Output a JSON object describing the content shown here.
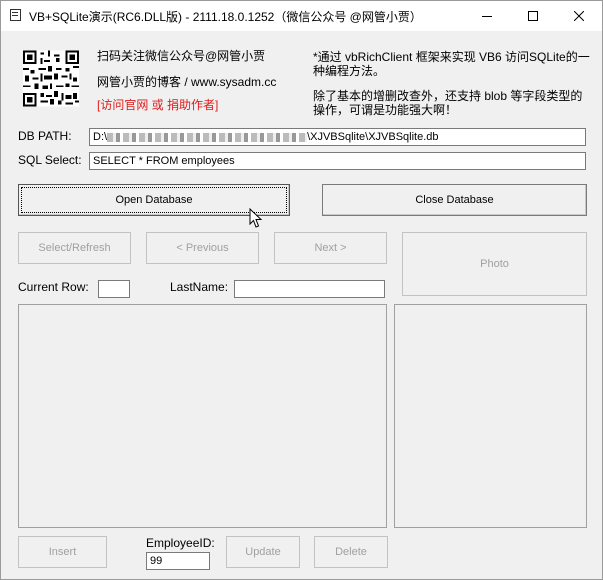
{
  "window": {
    "title": "VB+SQLite演示(RC6.DLL版) - 2111.18.0.1252（微信公众号 @网管小贾）"
  },
  "header": {
    "scan_text": "扫码关注微信公众号@网管小贾",
    "blog_text": "网管小贾的博客 / www.sysadm.cc",
    "link_text": "[访问官网 或 捐助作者]",
    "desc_line1": "*通过 vbRichClient 框架来实现 VB6 访问SQLite的一",
    "desc_line2": "种编程方法。",
    "desc_line3": "除了基本的增删改查外，还支持 blob 等字段类型的",
    "desc_line4": "操作，可谓是功能强大啊！"
  },
  "form": {
    "db_path_label": "DB PATH:",
    "db_path_prefix": "D:\\",
    "db_path_suffix": "\\XJVBSqlite\\XJVBSqlite.db",
    "sql_label": "SQL Select:",
    "sql_value": "SELECT * FROM employees",
    "current_row_label": "Current Row:",
    "current_row_value": "",
    "lastname_label": "LastName:",
    "lastname_value": "",
    "employee_id_label": "EmployeeID:",
    "employee_id_value": "99"
  },
  "buttons": {
    "open_db": "Open Database",
    "close_db": "Close Database",
    "select_refresh": "Select/Refresh",
    "previous": "< Previous",
    "next": "Next >",
    "photo": "Photo",
    "insert": "Insert",
    "update": "Update",
    "delete": "Delete"
  }
}
